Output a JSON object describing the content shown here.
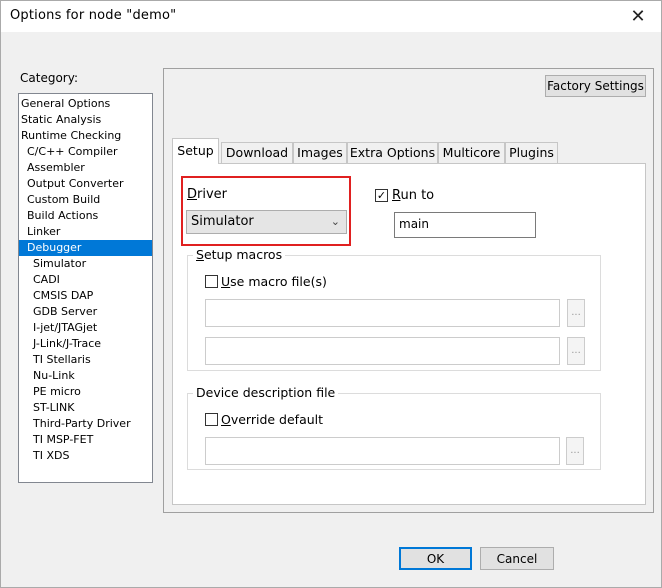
{
  "window": {
    "title": "Options for node \"demo\""
  },
  "category": {
    "label": "Category:",
    "items": [
      "General Options",
      "Static Analysis",
      "Runtime Checking",
      "C/C++ Compiler",
      "Assembler",
      "Output Converter",
      "Custom Build",
      "Build Actions",
      "Linker",
      "Debugger",
      "Simulator",
      "CADI",
      "CMSIS DAP",
      "GDB Server",
      "I-jet/JTAGjet",
      "J-Link/J-Trace",
      "TI Stellaris",
      "Nu-Link",
      "PE micro",
      "ST-LINK",
      "Third-Party Driver",
      "TI MSP-FET",
      "TI XDS"
    ],
    "selected": "Debugger"
  },
  "factory_settings_label": "Factory Settings",
  "tabs": [
    "Setup",
    "Download",
    "Images",
    "Extra Options",
    "Multicore",
    "Plugins"
  ],
  "active_tab": "Setup",
  "setup": {
    "driver_label": "Driver",
    "driver_value": "Simulator",
    "run_to_label": "Run to",
    "run_to_checked": true,
    "run_to_value": "main",
    "macros_group_label": "Setup macros",
    "use_macro_label": "Use macro file(s)",
    "use_macro_checked": false,
    "device_group_label": "Device description file",
    "override_label": "Override default",
    "override_checked": false,
    "browse_label": "..."
  },
  "buttons": {
    "ok": "OK",
    "cancel": "Cancel"
  }
}
